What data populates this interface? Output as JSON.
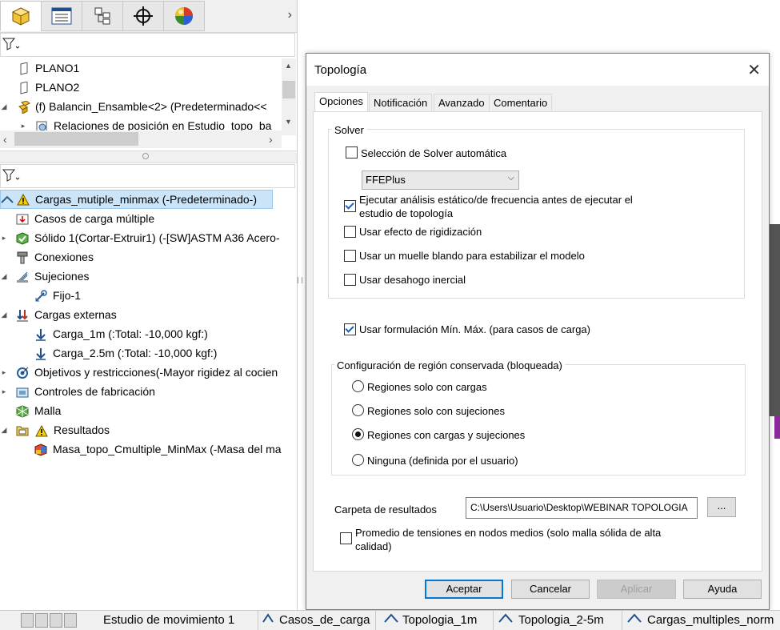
{
  "left_panel": {
    "tree_top": [
      {
        "label": "PLANO1"
      },
      {
        "label": "PLANO2"
      },
      {
        "label": "(f) Balancin_Ensamble<2> (Predeterminado<<"
      },
      {
        "label": "Relaciones de posición en Estudio_topo_ba"
      }
    ],
    "tree_bottom": [
      {
        "label": "Cargas_mutiple_minmax (-Predeterminado-)"
      },
      {
        "label": "Casos de carga múltiple"
      },
      {
        "label": "Sólido 1(Cortar-Extruir1) (-[SW]ASTM A36 Acero-"
      },
      {
        "label": "Conexiones"
      },
      {
        "label": "Sujeciones"
      },
      {
        "label": "Fijo-1"
      },
      {
        "label": "Cargas externas"
      },
      {
        "label": "Carga_1m (:Total: -10,000 kgf:)"
      },
      {
        "label": "Carga_2.5m (:Total: -10,000 kgf:)"
      },
      {
        "label": "Objetivos y restricciones(-Mayor rigidez al cocien"
      },
      {
        "label": "Controles de fabricación"
      },
      {
        "label": "Malla"
      },
      {
        "label": "Resultados"
      },
      {
        "label": "Masa_topo_Cmultiple_MinMax (-Masa del ma"
      }
    ]
  },
  "dialog": {
    "title": "Topología",
    "tabs": [
      "Opciones",
      "Notificación",
      "Avanzado",
      "Comentario"
    ],
    "solver": {
      "group_label": "Solver",
      "auto_solver_label": "Selección de Solver automática",
      "auto_solver_checked": false,
      "solver_value": "FFEPlus",
      "static_analysis_label_1": "Ejecutar análisis estático/de frecuencia antes de ejecutar el",
      "static_analysis_label_2": "estudio de topología",
      "static_analysis_checked": true,
      "stiffening_label": "Usar efecto de rigidización",
      "soft_spring_label": "Usar un muelle blando para estabilizar el modelo",
      "inertial_relief_label": "Usar desahogo inercial"
    },
    "minmax_label": "Usar formulación Mín. Máx. (para casos de carga)",
    "minmax_checked": true,
    "region": {
      "group_label": "Configuración de región conservada (bloqueada)",
      "options": [
        "Regiones solo con cargas",
        "Regiones solo con sujeciones",
        "Regiones con cargas y sujeciones",
        "Ninguna (definida por el usuario)"
      ],
      "selected": "Regiones con cargas y sujeciones"
    },
    "results_folder_label": "Carpeta de resultados",
    "results_folder_value": "C:\\Users\\Usuario\\Desktop\\WEBINAR TOPOLOGIA",
    "browse_label": "...",
    "avg_stress_label_1": "Promedio de tensiones en nodos medios (solo malla sólida de alta",
    "avg_stress_label_2": "calidad)",
    "buttons": {
      "ok": "Aceptar",
      "cancel": "Cancelar",
      "apply": "Aplicar",
      "help": "Ayuda"
    }
  },
  "bottom_tabs": [
    "Estudio de movimiento 1",
    "Casos_de_carga",
    "Topologia_1m",
    "Topologia_2-5m",
    "Cargas_multiples_norm"
  ],
  "colors": {
    "selection": "#cce4f7",
    "accent": "#0078d7"
  }
}
